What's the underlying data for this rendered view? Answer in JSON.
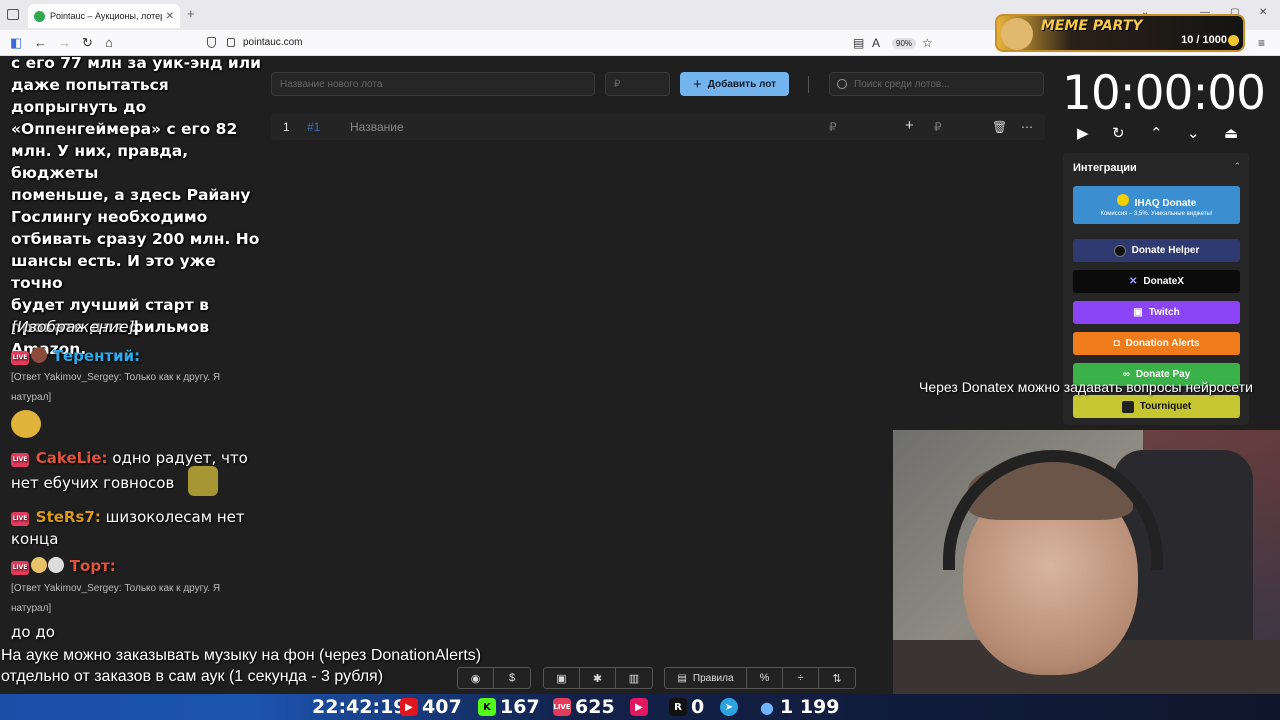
{
  "browser": {
    "tab_title": "Pointauc – Аукционы, лотереи",
    "url": "pointauc.com",
    "zoom": "90%"
  },
  "auction": {
    "new_lot_placeholder": "Название нового лота",
    "amount_placeholder": "₽",
    "add_lot_label": "Добавить лот",
    "search_placeholder": "Поиск среди лотов...",
    "row": {
      "index": "1",
      "id": "#1",
      "name": "Название",
      "currency1": "₽",
      "currency2": "₽"
    }
  },
  "timer": {
    "value": "10:00:00"
  },
  "integrations": {
    "header": "Интеграции",
    "buttons": [
      {
        "label": "IHAQ Donate",
        "sub": "Комиссия – 3,5%. Уникальные виджеты!",
        "color": "#3b8fd0"
      },
      {
        "label": "Donate Helper",
        "color": "#2e3a70"
      },
      {
        "label": "DonateX",
        "color": "#0b0b0b"
      },
      {
        "label": "Twitch",
        "color": "#8c44f7"
      },
      {
        "label": "Donation Alerts",
        "color": "#f07b1a"
      },
      {
        "label": "Donate Pay",
        "color": "#3bb14a"
      },
      {
        "label": "Tourniquet",
        "color": "#c6c630"
      }
    ]
  },
  "overlay": {
    "donatex_note": "Через Donatex можно задавать вопросы нейросети",
    "music_line1": "На ауке можно заказывать музыку на фон (через DonationAlerts)",
    "music_line2": "отдельно от заказов в сам аук (1 секунда - 3 рубля)"
  },
  "chat": {
    "big_lines": [
      "с его 77 млн за уик-энд или",
      "даже попытаться",
      "допрыгнуть до",
      "«Оппенгеймера» с его 82",
      "млн. У них, правда, бюджеты",
      "поменьше, а здесь Райану",
      "Гослингу необходимо",
      "отбивать сразу 200 млн. Но",
      "шансы есть. И это уже точно",
      "будет лучший старт в",
      "прокате для фильмов",
      "Amazon."
    ],
    "image_tag": "[Изображение]",
    "m1_nick": "Терентий:",
    "m1_reply1": "[Ответ Yakimov_Sergey: Только как к другу. Я",
    "m1_reply2": "натурал]",
    "m2_nick": "CakeLie:",
    "m2_text1": "одно радует, что",
    "m2_text2": "нет ебучих говносов",
    "m3_nick": "SteRs7:",
    "m3_text1": "шизоколесам нет",
    "m3_text2": "конца",
    "m4_nick": "Торт:",
    "m4_reply1": "[Ответ Yakimov_Sergey: Только как к другу. Я",
    "m4_reply2": "натурал]",
    "m4_text": "до до",
    "live_label": "LIVE"
  },
  "toolbar": {
    "rules_label": "Правила"
  },
  "streambar": {
    "time": "22:42:19",
    "youtube": "407",
    "kick": "167",
    "vk": "625",
    "rutube": "0",
    "telegram": "",
    "viewers": "1 199",
    "r_label": "R"
  },
  "meme_party": {
    "title": "MEME PARTY",
    "count": "10 / 1000"
  }
}
